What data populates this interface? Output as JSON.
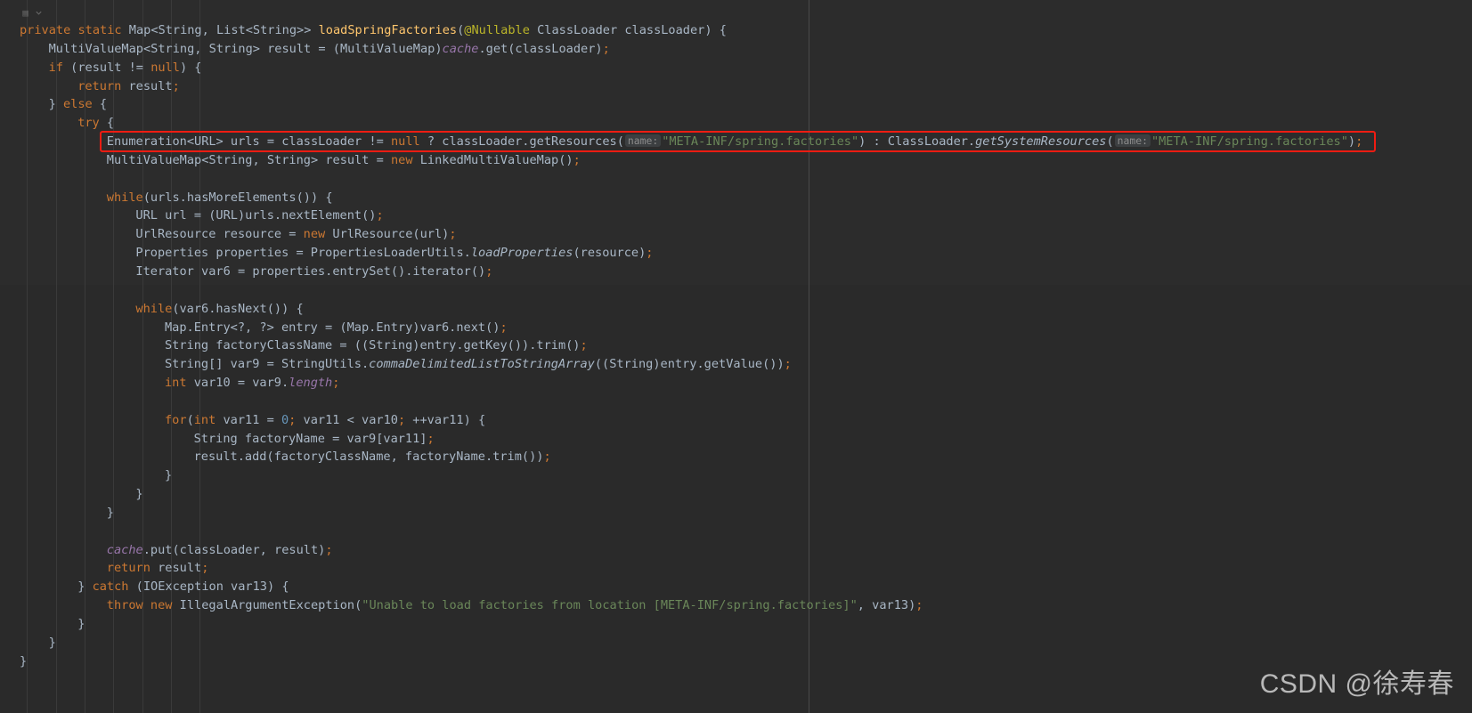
{
  "editor": {
    "theme": "darcula",
    "background_color": "#2b2b2b",
    "default_text_color": "#a9b7c6",
    "keyword_color": "#cc7832",
    "string_color": "#6a8759",
    "method_color": "#ffc66d",
    "annotation_color": "#bbb529",
    "field_color": "#9876aa",
    "number_color": "#6897bb",
    "hint_background_color": "#3c3f41",
    "hint_text_color": "#8c8c8c",
    "highlight_box_color": "#f01c12",
    "language": "Java"
  },
  "gutter": {
    "fold_icon": "fold-region-icon",
    "chevron_icon": "chevron-down-icon"
  },
  "highlight": {
    "line_index": 6,
    "label": "Enumeration<URL> urls = classLoader != null ? classLoader.getResources( name: \"META-INF/spring.factories\") : ClassLoader.getSystemResources( name: \"META-INF/spring.factories\");"
  },
  "hints": {
    "name_param": "name:"
  },
  "watermark": {
    "text": "CSDN @徐寿春"
  },
  "code_lines": [
    {
      "index": 0,
      "indent": 0,
      "text": "private static Map<String, List<String>> loadSpringFactories(@Nullable ClassLoader classLoader) {",
      "tokens": [
        {
          "t": "private",
          "c": "kw"
        },
        {
          "t": " ",
          "c": "pun"
        },
        {
          "t": "static",
          "c": "kw"
        },
        {
          "t": " Map<String, List<String>> ",
          "c": "typ"
        },
        {
          "t": "loadSpringFactories",
          "c": "mth"
        },
        {
          "t": "(",
          "c": "pun"
        },
        {
          "t": "@Nullable",
          "c": "ann"
        },
        {
          "t": " ClassLoader classLoader",
          "c": "typ"
        },
        {
          "t": ") {",
          "c": "pun"
        }
      ]
    },
    {
      "index": 1,
      "indent": 1,
      "text": "MultiValueMap<String, String> result = (MultiValueMap)cache.get(classLoader);",
      "tokens": [
        {
          "t": "MultiValueMap<String, String> result = (MultiValueMap)",
          "c": "typ"
        },
        {
          "t": "cache",
          "c": "fld"
        },
        {
          "t": ".get(classLoader)",
          "c": "typ"
        },
        {
          "t": ";",
          "c": "semi"
        }
      ]
    },
    {
      "index": 2,
      "indent": 1,
      "text": "if (result != null) {",
      "tokens": [
        {
          "t": "if",
          "c": "kw"
        },
        {
          "t": " (result != ",
          "c": "typ"
        },
        {
          "t": "null",
          "c": "kw"
        },
        {
          "t": ") {",
          "c": "typ"
        }
      ]
    },
    {
      "index": 3,
      "indent": 2,
      "text": "return result;",
      "tokens": [
        {
          "t": "return",
          "c": "kw"
        },
        {
          "t": " result",
          "c": "typ"
        },
        {
          "t": ";",
          "c": "semi"
        }
      ]
    },
    {
      "index": 4,
      "indent": 1,
      "text": "} else {",
      "tokens": [
        {
          "t": "} ",
          "c": "typ"
        },
        {
          "t": "else",
          "c": "kw"
        },
        {
          "t": " {",
          "c": "typ"
        }
      ]
    },
    {
      "index": 5,
      "indent": 2,
      "text": "try {",
      "tokens": [
        {
          "t": "try",
          "c": "kw"
        },
        {
          "t": " {",
          "c": "typ"
        }
      ]
    },
    {
      "index": 6,
      "indent": 3,
      "text": "Enumeration<URL> urls = classLoader != null ? classLoader.getResources( name: \"META-INF/spring.factories\") : ClassLoader.getSystemResources( name: \"META-INF/spring.factories\");",
      "tokens": [
        {
          "t": "Enumeration<URL> urls = classLoader != ",
          "c": "typ"
        },
        {
          "t": "null",
          "c": "kw"
        },
        {
          "t": " ? classLoader.getResources(",
          "c": "typ"
        },
        {
          "t": "name:",
          "c": "hint"
        },
        {
          "t": "\"META-INF/spring.factories\"",
          "c": "str"
        },
        {
          "t": ") : ClassLoader.",
          "c": "typ"
        },
        {
          "t": "getSystemResources",
          "c": "stm"
        },
        {
          "t": "(",
          "c": "typ"
        },
        {
          "t": "name:",
          "c": "hint"
        },
        {
          "t": "\"META-INF/spring.factories\"",
          "c": "str"
        },
        {
          "t": ")",
          "c": "typ"
        },
        {
          "t": ";",
          "c": "semi"
        }
      ]
    },
    {
      "index": 7,
      "indent": 3,
      "text": "MultiValueMap<String, String> result = new LinkedMultiValueMap();",
      "tokens": [
        {
          "t": "MultiValueMap<String, String> result = ",
          "c": "typ"
        },
        {
          "t": "new",
          "c": "kw"
        },
        {
          "t": " LinkedMultiValueMap()",
          "c": "typ"
        },
        {
          "t": ";",
          "c": "semi"
        }
      ]
    },
    {
      "index": 8,
      "indent": 0,
      "text": "",
      "tokens": []
    },
    {
      "index": 9,
      "indent": 3,
      "text": "while(urls.hasMoreElements()) {",
      "tokens": [
        {
          "t": "while",
          "c": "kw"
        },
        {
          "t": "(urls.hasMoreElements()) {",
          "c": "typ"
        }
      ]
    },
    {
      "index": 10,
      "indent": 4,
      "text": "URL url = (URL)urls.nextElement();",
      "tokens": [
        {
          "t": "URL url = (URL)urls.nextElement()",
          "c": "typ"
        },
        {
          "t": ";",
          "c": "semi"
        }
      ]
    },
    {
      "index": 11,
      "indent": 4,
      "text": "UrlResource resource = new UrlResource(url);",
      "tokens": [
        {
          "t": "UrlResource resource = ",
          "c": "typ"
        },
        {
          "t": "new",
          "c": "kw"
        },
        {
          "t": " UrlResource(url)",
          "c": "typ"
        },
        {
          "t": ";",
          "c": "semi"
        }
      ]
    },
    {
      "index": 12,
      "indent": 4,
      "text": "Properties properties = PropertiesLoaderUtils.loadProperties(resource);",
      "tokens": [
        {
          "t": "Properties properties = PropertiesLoaderUtils.",
          "c": "typ"
        },
        {
          "t": "loadProperties",
          "c": "stm"
        },
        {
          "t": "(resource)",
          "c": "typ"
        },
        {
          "t": ";",
          "c": "semi"
        }
      ]
    },
    {
      "index": 13,
      "indent": 4,
      "text": "Iterator var6 = properties.entrySet().iterator();",
      "tokens": [
        {
          "t": "Iterator var6 = properties.entrySet().iterator()",
          "c": "typ"
        },
        {
          "t": ";",
          "c": "semi"
        }
      ]
    },
    {
      "index": 14,
      "indent": 0,
      "text": "",
      "tokens": []
    },
    {
      "index": 15,
      "indent": 4,
      "text": "while(var6.hasNext()) {",
      "tokens": [
        {
          "t": "while",
          "c": "kw"
        },
        {
          "t": "(var6.hasNext()) {",
          "c": "typ"
        }
      ]
    },
    {
      "index": 16,
      "indent": 5,
      "text": "Map.Entry<?, ?> entry = (Map.Entry)var6.next();",
      "tokens": [
        {
          "t": "Map.Entry<?, ?> entry = (Map.Entry)var6.next()",
          "c": "typ"
        },
        {
          "t": ";",
          "c": "semi"
        }
      ]
    },
    {
      "index": 17,
      "indent": 5,
      "text": "String factoryClassName = ((String)entry.getKey()).trim();",
      "tokens": [
        {
          "t": "String factoryClassName = ((String)entry.getKey()).trim()",
          "c": "typ"
        },
        {
          "t": ";",
          "c": "semi"
        }
      ]
    },
    {
      "index": 18,
      "indent": 5,
      "text": "String[] var9 = StringUtils.commaDelimitedListToStringArray((String)entry.getValue());",
      "tokens": [
        {
          "t": "String[] var9 = StringUtils.",
          "c": "typ"
        },
        {
          "t": "commaDelimitedListToStringArray",
          "c": "stm"
        },
        {
          "t": "((String)entry.getValue())",
          "c": "typ"
        },
        {
          "t": ";",
          "c": "semi"
        }
      ]
    },
    {
      "index": 19,
      "indent": 5,
      "text": "int var10 = var9.length;",
      "tokens": [
        {
          "t": "int",
          "c": "kw"
        },
        {
          "t": " var10 = var9.",
          "c": "typ"
        },
        {
          "t": "length",
          "c": "fld"
        },
        {
          "t": ";",
          "c": "semi"
        }
      ]
    },
    {
      "index": 20,
      "indent": 0,
      "text": "",
      "tokens": []
    },
    {
      "index": 21,
      "indent": 5,
      "text": "for(int var11 = 0; var11 < var10; ++var11) {",
      "tokens": [
        {
          "t": "for",
          "c": "kw"
        },
        {
          "t": "(",
          "c": "typ"
        },
        {
          "t": "int",
          "c": "kw"
        },
        {
          "t": " var11 = ",
          "c": "typ"
        },
        {
          "t": "0",
          "c": "num"
        },
        {
          "t": ";",
          "c": "semi"
        },
        {
          "t": " var11 < var10",
          "c": "typ"
        },
        {
          "t": ";",
          "c": "semi"
        },
        {
          "t": " ++var11) {",
          "c": "typ"
        }
      ]
    },
    {
      "index": 22,
      "indent": 6,
      "text": "String factoryName = var9[var11];",
      "tokens": [
        {
          "t": "String factoryName = var9[var11]",
          "c": "typ"
        },
        {
          "t": ";",
          "c": "semi"
        }
      ]
    },
    {
      "index": 23,
      "indent": 6,
      "text": "result.add(factoryClassName, factoryName.trim());",
      "tokens": [
        {
          "t": "result.add(factoryClassName, factoryName.trim())",
          "c": "typ"
        },
        {
          "t": ";",
          "c": "semi"
        }
      ]
    },
    {
      "index": 24,
      "indent": 5,
      "text": "}",
      "tokens": [
        {
          "t": "}",
          "c": "typ"
        }
      ]
    },
    {
      "index": 25,
      "indent": 4,
      "text": "}",
      "tokens": [
        {
          "t": "}",
          "c": "typ"
        }
      ]
    },
    {
      "index": 26,
      "indent": 3,
      "text": "}",
      "tokens": [
        {
          "t": "}",
          "c": "typ"
        }
      ]
    },
    {
      "index": 27,
      "indent": 0,
      "text": "",
      "tokens": []
    },
    {
      "index": 28,
      "indent": 3,
      "text": "cache.put(classLoader, result);",
      "tokens": [
        {
          "t": "cache",
          "c": "fld"
        },
        {
          "t": ".put(classLoader, result)",
          "c": "typ"
        },
        {
          "t": ";",
          "c": "semi"
        }
      ]
    },
    {
      "index": 29,
      "indent": 3,
      "text": "return result;",
      "tokens": [
        {
          "t": "return",
          "c": "kw"
        },
        {
          "t": " result",
          "c": "typ"
        },
        {
          "t": ";",
          "c": "semi"
        }
      ]
    },
    {
      "index": 30,
      "indent": 2,
      "text": "} catch (IOException var13) {",
      "tokens": [
        {
          "t": "} ",
          "c": "typ"
        },
        {
          "t": "catch",
          "c": "kw"
        },
        {
          "t": " (IOException var13) {",
          "c": "typ"
        }
      ]
    },
    {
      "index": 31,
      "indent": 3,
      "text": "throw new IllegalArgumentException(\"Unable to load factories from location [META-INF/spring.factories]\", var13);",
      "tokens": [
        {
          "t": "throw",
          "c": "kw"
        },
        {
          "t": " ",
          "c": "typ"
        },
        {
          "t": "new",
          "c": "kw"
        },
        {
          "t": " IllegalArgumentException(",
          "c": "typ"
        },
        {
          "t": "\"Unable to load factories from location [META-INF/spring.factories]\"",
          "c": "str"
        },
        {
          "t": ", var13)",
          "c": "typ"
        },
        {
          "t": ";",
          "c": "semi"
        }
      ]
    },
    {
      "index": 32,
      "indent": 2,
      "text": "}",
      "tokens": [
        {
          "t": "}",
          "c": "typ"
        }
      ]
    },
    {
      "index": 33,
      "indent": 1,
      "text": "}",
      "tokens": [
        {
          "t": "}",
          "c": "typ"
        }
      ]
    },
    {
      "index": 34,
      "indent": 0,
      "text": "}",
      "tokens": [
        {
          "t": "}",
          "c": "typ"
        }
      ]
    }
  ],
  "indent_guides_x": [
    30,
    63,
    95,
    127,
    160,
    192,
    224
  ],
  "margin_line_x": 908
}
